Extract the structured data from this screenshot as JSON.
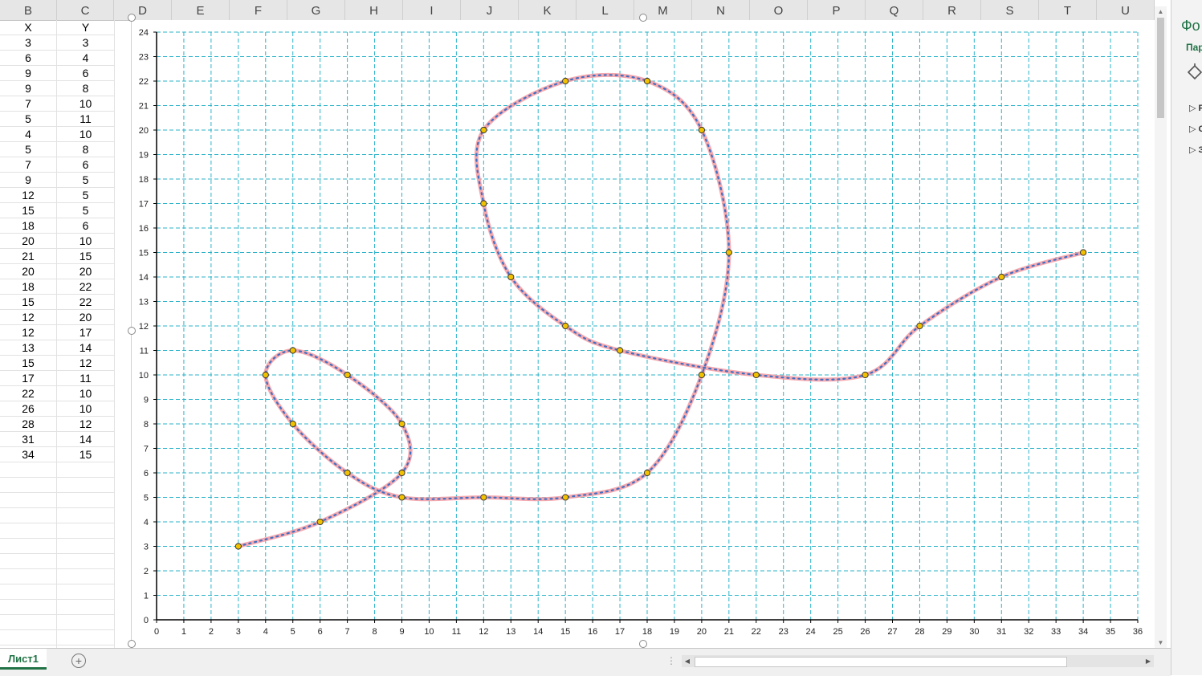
{
  "spreadsheet": {
    "columns": [
      "B",
      "C",
      "D",
      "E",
      "F",
      "G",
      "H",
      "I",
      "J",
      "K",
      "L",
      "M",
      "N",
      "O",
      "P",
      "Q",
      "R",
      "S",
      "T",
      "U"
    ],
    "table": {
      "headers": [
        "X",
        "Y"
      ],
      "rows": [
        [
          3,
          3
        ],
        [
          6,
          4
        ],
        [
          9,
          6
        ],
        [
          9,
          8
        ],
        [
          7,
          10
        ],
        [
          5,
          11
        ],
        [
          4,
          10
        ],
        [
          5,
          8
        ],
        [
          7,
          6
        ],
        [
          9,
          5
        ],
        [
          12,
          5
        ],
        [
          15,
          5
        ],
        [
          18,
          6
        ],
        [
          20,
          10
        ],
        [
          21,
          15
        ],
        [
          20,
          20
        ],
        [
          18,
          22
        ],
        [
          15,
          22
        ],
        [
          12,
          20
        ],
        [
          12,
          17
        ],
        [
          13,
          14
        ],
        [
          15,
          12
        ],
        [
          17,
          11
        ],
        [
          22,
          10
        ],
        [
          26,
          10
        ],
        [
          28,
          12
        ],
        [
          31,
          14
        ],
        [
          34,
          15
        ]
      ]
    }
  },
  "chart_data": {
    "type": "scatter",
    "series": [
      {
        "x": [
          3,
          6,
          9,
          9,
          7,
          5,
          4,
          5,
          7,
          9,
          12,
          15,
          18,
          20,
          21,
          20,
          18,
          15,
          12,
          12,
          13,
          15,
          17,
          22,
          26,
          28,
          31,
          34
        ],
        "y": [
          3,
          4,
          6,
          8,
          10,
          11,
          10,
          8,
          6,
          5,
          5,
          5,
          6,
          10,
          15,
          20,
          22,
          22,
          20,
          17,
          14,
          12,
          11,
          10,
          10,
          12,
          14,
          15
        ]
      }
    ],
    "xlim": [
      0,
      36
    ],
    "ylim": [
      0,
      24
    ],
    "x_ticks": [
      0,
      1,
      2,
      3,
      4,
      5,
      6,
      7,
      8,
      9,
      10,
      11,
      12,
      13,
      14,
      15,
      16,
      17,
      18,
      19,
      20,
      21,
      22,
      23,
      24,
      25,
      26,
      27,
      28,
      29,
      30,
      31,
      32,
      33,
      34,
      35,
      36
    ],
    "y_ticks": [
      0,
      1,
      2,
      3,
      4,
      5,
      6,
      7,
      8,
      9,
      10,
      11,
      12,
      13,
      14,
      15,
      16,
      17,
      18,
      19,
      20,
      21,
      22,
      23,
      24
    ],
    "grid": "dashed",
    "smooth": true,
    "colors": {
      "grid": "#2bb3c9",
      "line_glow": "#f4a0a6",
      "line": "#3d6fc4",
      "marker": "#f2c200"
    }
  },
  "sheet_tabs": {
    "active": "Лист1",
    "add_icon": "plus-circle-icon"
  },
  "right_pane": {
    "title": "Фо",
    "subtitle": "Пар",
    "items": [
      "F",
      "C",
      "З"
    ],
    "icon": "fill-bucket-icon"
  }
}
